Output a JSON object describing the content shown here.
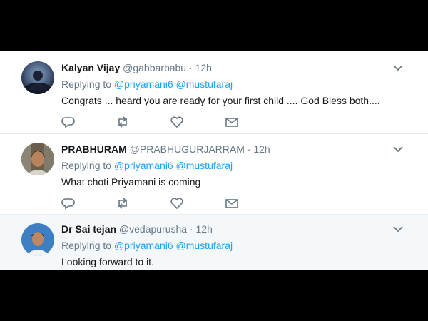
{
  "tweets": [
    {
      "name": "Kalyan Vijay",
      "handle": "@gabbarbabu",
      "dot": "·",
      "time": "12h",
      "replying_label": "Replying to",
      "mentions": [
        "@priyamani6",
        "@mustufaraj"
      ],
      "text": "Congrats ... heard you are ready for your first child .... God Bless both...."
    },
    {
      "name": "PRABHURAM",
      "handle": "@PRABHUGURJARRAM",
      "dot": "·",
      "time": "12h",
      "replying_label": "Replying to",
      "mentions": [
        "@priyamani6",
        "@mustufaraj"
      ],
      "text": "What choti Priyamani is coming"
    },
    {
      "name": "Dr Sai tejan",
      "handle": "@vedapurusha",
      "dot": "·",
      "time": "12h",
      "replying_label": "Replying to",
      "mentions": [
        "@priyamani6",
        "@mustufaraj"
      ],
      "text": "Looking forward to it."
    }
  ],
  "icons": {
    "reply": "reply-icon",
    "retweet": "retweet-icon",
    "like": "heart-icon",
    "dm": "envelope-icon",
    "more": "chevron-down-icon"
  },
  "colors": {
    "link": "#1da1f2",
    "muted": "#657786",
    "text": "#14171a"
  }
}
